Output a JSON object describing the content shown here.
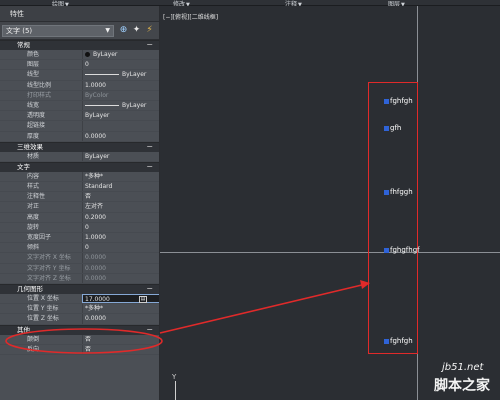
{
  "ribbon": {
    "tabs": [
      "绘图",
      "修改",
      "注释",
      "图层"
    ]
  },
  "palette": {
    "title": "特性",
    "selector": {
      "value": "文字 (5)"
    },
    "categories": [
      {
        "title": "常规",
        "rows": [
          {
            "label": "颜色",
            "value": "ByLayer",
            "kind": "color"
          },
          {
            "label": "图层",
            "value": "0"
          },
          {
            "label": "线型",
            "value": "ByLayer",
            "kind": "line"
          },
          {
            "label": "线型比例",
            "value": "1.0000"
          },
          {
            "label": "打印样式",
            "value": "ByColor",
            "disabled": true
          },
          {
            "label": "线宽",
            "value": "ByLayer",
            "kind": "line"
          },
          {
            "label": "透明度",
            "value": "ByLayer"
          },
          {
            "label": "超链接",
            "value": ""
          },
          {
            "label": "厚度",
            "value": "0.0000"
          }
        ]
      },
      {
        "title": "三维效果",
        "rows": [
          {
            "label": "材质",
            "value": "ByLayer"
          }
        ]
      },
      {
        "title": "文字",
        "rows": [
          {
            "label": "内容",
            "value": "*多种*"
          },
          {
            "label": "样式",
            "value": "Standard"
          },
          {
            "label": "注释性",
            "value": "否"
          },
          {
            "label": "对正",
            "value": "左对齐"
          },
          {
            "label": "高度",
            "value": "0.2000"
          },
          {
            "label": "旋转",
            "value": "0"
          },
          {
            "label": "宽度因子",
            "value": "1.0000"
          },
          {
            "label": "倾斜",
            "value": "0"
          },
          {
            "label": "文字对齐 X 坐标",
            "value": "0.0000",
            "disabled": true
          },
          {
            "label": "文字对齐 Y 坐标",
            "value": "0.0000",
            "disabled": true
          },
          {
            "label": "文字对齐 Z 坐标",
            "value": "0.0000",
            "disabled": true
          }
        ]
      },
      {
        "title": "几何图形",
        "rows": [
          {
            "label": "位置 X 坐标",
            "value": "17.0000",
            "selected": true
          },
          {
            "label": "位置 Y 坐标",
            "value": "*多种*"
          },
          {
            "label": "位置 Z 坐标",
            "value": "0.0000"
          }
        ]
      },
      {
        "title": "其他",
        "rows": [
          {
            "label": "颠倒",
            "value": "否"
          },
          {
            "label": "反向",
            "value": "否"
          }
        ]
      }
    ]
  },
  "viewport": {
    "label": "[−][俯视][二维线框]"
  },
  "drawing": {
    "texts": [
      "fghfgh",
      "gfh",
      "fhfggh",
      "fghgfhgf",
      "fghfgh"
    ],
    "ucs_label": "Y"
  },
  "watermark": {
    "url": "jb51.net",
    "logo": "脚本之家"
  },
  "colors": {
    "highlight": "#e02a2a",
    "grip": "#2f63d8",
    "canvas": "#2b2e33",
    "palette": "#4b4f55"
  }
}
